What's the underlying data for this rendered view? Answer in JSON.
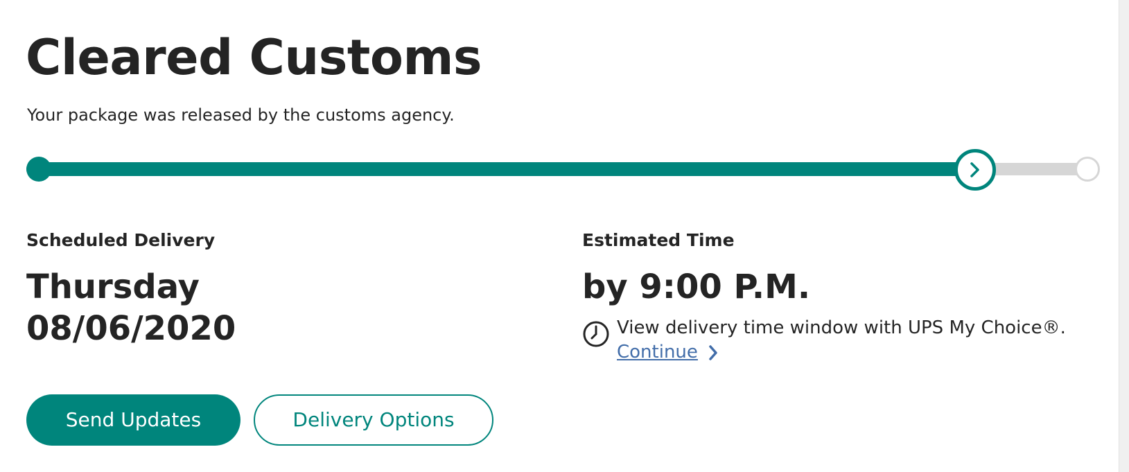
{
  "status": {
    "title": "Cleared Customs",
    "description": "Your package was released by the customs agency."
  },
  "progress": {
    "percent_complete": 89,
    "steps_total": 3,
    "current_step": 2,
    "accent_color": "#00857c",
    "remaining_color": "#d6d6d6",
    "current_marker_icon": "chevron-right-icon"
  },
  "delivery": {
    "scheduled_label": "Scheduled Delivery",
    "day": "Thursday",
    "date": "08/06/2020",
    "estimated_label": "Estimated Time",
    "estimated_time": "by 9:00 P.M.",
    "my_choice_icon": "clock-icon",
    "my_choice_text": "View delivery time window with UPS My Choice®.",
    "continue_label": "Continue",
    "link_color": "#426da9"
  },
  "actions": {
    "send_updates_label": "Send Updates",
    "delivery_options_label": "Delivery Options"
  }
}
